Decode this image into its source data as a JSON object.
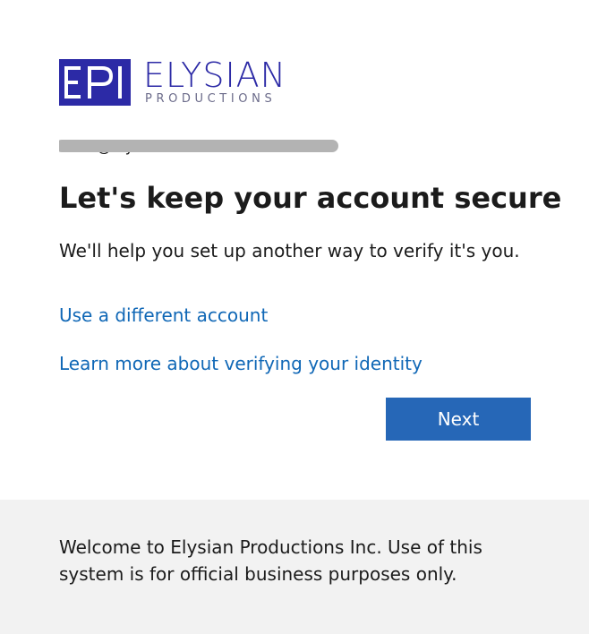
{
  "brand": {
    "mark": "EPI",
    "name": "ELYSIAN",
    "tagline": "PRODUCTIONS",
    "color": "#2c2aa6"
  },
  "identity": {
    "email_visible": "twi...@elysianonline.com"
  },
  "page": {
    "title": "Let's keep your account secure",
    "description": "We'll help you set up another way to verify it's you."
  },
  "links": {
    "different_account": "Use a different account",
    "learn_more": "Learn more about verifying your identity",
    "color": "#0f67b6"
  },
  "actions": {
    "next_label": "Next",
    "button_color": "#2667b7"
  },
  "footer": {
    "text": "Welcome to Elysian Productions Inc. Use of this system is for official business purposes only."
  }
}
